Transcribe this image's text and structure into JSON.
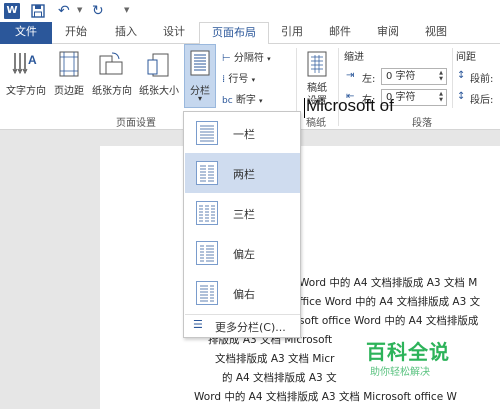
{
  "quick_access": {
    "app_logo": "W",
    "icons": [
      "word-logo-icon",
      "save-icon",
      "undo-icon",
      "redo-icon",
      "customize-icon"
    ]
  },
  "tabs": [
    {
      "label": "文件"
    },
    {
      "label": "开始"
    },
    {
      "label": "插入"
    },
    {
      "label": "设计"
    },
    {
      "label": "页面布局"
    },
    {
      "label": "引用"
    },
    {
      "label": "邮件"
    },
    {
      "label": "审阅"
    },
    {
      "label": "视图"
    }
  ],
  "ribbon": {
    "page_setup": {
      "text_direction": "文字方向",
      "margins": "页边距",
      "orientation": "纸张方向",
      "size": "纸张大小",
      "columns": "分栏",
      "columns_arrow": "▾",
      "breaks": "分隔符",
      "line_numbers": "行号",
      "hyphenation": "断字",
      "group_label": "页面设置"
    },
    "manuscript": {
      "label": "稿纸\n设置",
      "label_line1": "稿纸",
      "label_line2": "设置",
      "group_label": "稿纸"
    },
    "paragraph": {
      "indent_header": "缩进",
      "indent_left_label": "左:",
      "indent_left_value": "0 字符",
      "indent_right_label": "右:",
      "indent_right_value": "0 字符",
      "spacing_header": "间距",
      "spacing_before_label": "段前:",
      "spacing_after_label": "段后:",
      "group_label": "段落"
    }
  },
  "columns_menu": {
    "items": [
      {
        "label": "一栏"
      },
      {
        "label": "两栏"
      },
      {
        "label": "三栏"
      },
      {
        "label": "偏左"
      },
      {
        "label": "偏右"
      }
    ],
    "more": "更多分栏(C)..."
  },
  "document": {
    "title": "Microsoft of",
    "lines": [
      "Word 中的 A4 文档排版成 A3 文档 M",
      "ffice Word 中的 A4 文档排版成 A3 文",
      "soft office Word 中的 A4 文档排版成",
      "排版成 A3 文档 Microsoft",
      "文档排版成 A3 文档 Micr",
      "的 A4 文档排版成 A3 文",
      "Word 中的 A4 文档排版成 A3 文档 Microsoft office W"
    ]
  },
  "watermark": {
    "title": "百科全说",
    "subtitle": "助你轻松解决"
  }
}
